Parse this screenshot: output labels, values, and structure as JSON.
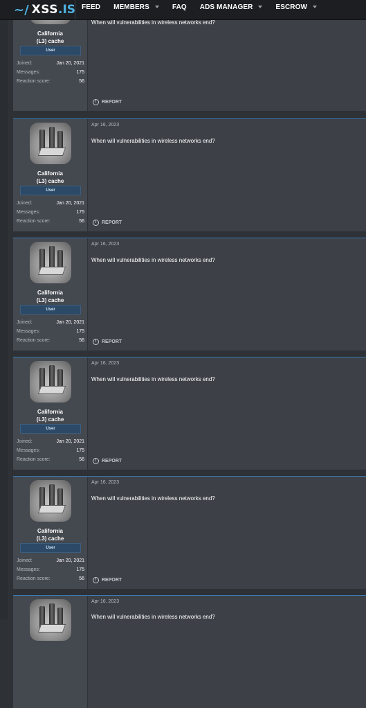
{
  "header": {
    "logo_tilde": "~/",
    "logo_xss": "XSS",
    "logo_is": ".IS",
    "nav": [
      {
        "label": "FEED",
        "caret": false
      },
      {
        "label": "MEMBERS",
        "caret": true
      },
      {
        "label": "FAQ",
        "caret": false
      },
      {
        "label": "ADS MANAGER",
        "caret": true
      },
      {
        "label": "ESCROW",
        "caret": true
      }
    ]
  },
  "posts": [
    {
      "date": "",
      "body": "When will vulnerabilities in wireless networks end?",
      "user": {
        "name1": "California",
        "name2": "(L3) cache",
        "role": "User",
        "joined_label": "Joined:",
        "joined": "Jan 20, 2021",
        "messages_label": "Messages:",
        "messages": "175",
        "reaction_label": "Reaction score:",
        "reaction": "56"
      },
      "report": "REPORT"
    },
    {
      "date": "Apr 16, 2023",
      "body": "When will vulnerabilities in wireless networks end?",
      "user": {
        "name1": "California",
        "name2": "(L3) cache",
        "role": "User",
        "joined_label": "Joined:",
        "joined": "Jan 20, 2021",
        "messages_label": "Messages:",
        "messages": "175",
        "reaction_label": "Reaction score:",
        "reaction": "56"
      },
      "report": "REPORT"
    },
    {
      "date": "Apr 16, 2023",
      "body": "When will vulnerabilities in wireless networks end?",
      "user": {
        "name1": "California",
        "name2": "(L3) cache",
        "role": "User",
        "joined_label": "Joined:",
        "joined": "Jan 20, 2021",
        "messages_label": "Messages:",
        "messages": "175",
        "reaction_label": "Reaction score:",
        "reaction": "56"
      },
      "report": "REPORT"
    },
    {
      "date": "Apr 16, 2023",
      "body": "When will vulnerabilities in wireless networks end?",
      "user": {
        "name1": "California",
        "name2": "(L3) cache",
        "role": "User",
        "joined_label": "Joined:",
        "joined": "Jan 20, 2021",
        "messages_label": "Messages:",
        "messages": "175",
        "reaction_label": "Reaction score:",
        "reaction": "56"
      },
      "report": "REPORT"
    },
    {
      "date": "Apr 16, 2023",
      "body": "When will vulnerabilities in wireless networks end?",
      "user": {
        "name1": "California",
        "name2": "(L3) cache",
        "role": "User",
        "joined_label": "Joined:",
        "joined": "Jan 20, 2021",
        "messages_label": "Messages:",
        "messages": "175",
        "reaction_label": "Reaction score:",
        "reaction": "56"
      },
      "report": "REPORT"
    },
    {
      "date": "Apr 16, 2023",
      "body": "When will vulnerabilities in wireless networks end?",
      "user": {
        "name1": "",
        "name2": "",
        "role": "",
        "joined_label": "",
        "joined": "",
        "messages_label": "",
        "messages": "",
        "reaction_label": "",
        "reaction": ""
      },
      "report": ""
    }
  ],
  "colors": {
    "accent": "#4fb3e3",
    "background": "#2e3135",
    "post_bg": "#3d4147",
    "user_bg": "#44484f",
    "role_badge": "#2c4a67"
  }
}
